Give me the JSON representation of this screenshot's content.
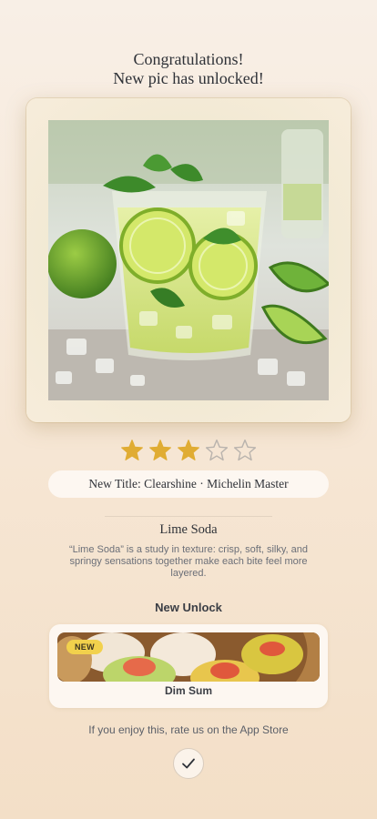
{
  "header": {
    "line1": "Congratulations!",
    "line2": "New pic has unlocked!"
  },
  "photo": {
    "subject": "lime soda drink in glass with mint, lime wedges and ice"
  },
  "rating": {
    "value": 3,
    "max": 5,
    "filled_color": "#e0ac33",
    "empty_color": "#b9b3ad"
  },
  "title_pill": {
    "text": "New Title: Clearshine · Michelin Master"
  },
  "dish": {
    "name": "Lime Soda",
    "description": "“Lime Soda” is a study in texture: crisp, soft, silky, and springy sensations together make each bite feel more layered."
  },
  "unlock": {
    "heading": "New Unlock",
    "badge": "NEW",
    "item_label": "Dim Sum"
  },
  "footer": {
    "rate_text": "If you enjoy this, rate us on the App Store",
    "done_icon": "checkmark-icon"
  }
}
